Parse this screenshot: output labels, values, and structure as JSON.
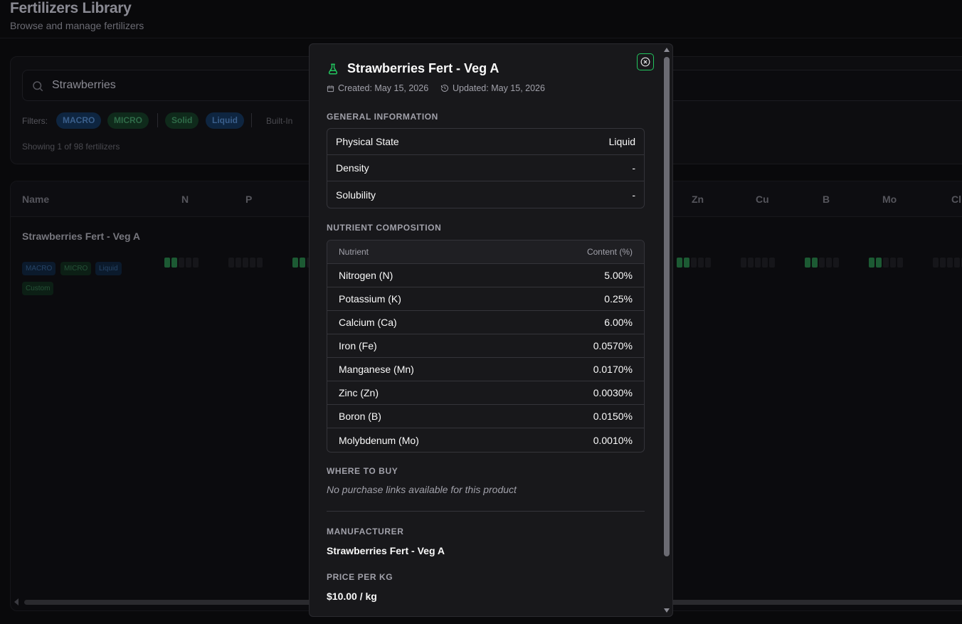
{
  "page": {
    "title": "Fertilizers Library",
    "subtitle": "Browse and manage fertilizers"
  },
  "search": {
    "value": "Strawberries",
    "filters_label": "Filters:",
    "chips": [
      "MACRO",
      "MICRO",
      "Solid",
      "Liquid"
    ],
    "more_chip": "Built-In",
    "showing": "Showing 1 of 98 fertilizers"
  },
  "table": {
    "headers": [
      "Name",
      "N",
      "P",
      "Zn",
      "Cu",
      "B",
      "Mo",
      "Cl"
    ],
    "row": {
      "name": "Strawberries Fert - Veg A",
      "tags": [
        "MACRO",
        "MICRO",
        "Liquid",
        "Custom"
      ]
    }
  },
  "modal": {
    "title": "Strawberries Fert - Veg A",
    "created": "Created: May 15, 2026",
    "updated": "Updated: May 15, 2026",
    "general_label": "GENERAL INFORMATION",
    "general": [
      {
        "label": "Physical State",
        "value": "Liquid"
      },
      {
        "label": "Density",
        "value": "-"
      },
      {
        "label": "Solubility",
        "value": "-"
      }
    ],
    "nutrient_label": "NUTRIENT COMPOSITION",
    "nutrient_headers": {
      "nutrient": "Nutrient",
      "content": "Content (%)"
    },
    "nutrients": [
      {
        "name": "Nitrogen (N)",
        "value": "5.00%"
      },
      {
        "name": "Potassium (K)",
        "value": "0.25%"
      },
      {
        "name": "Calcium (Ca)",
        "value": "6.00%"
      },
      {
        "name": "Iron (Fe)",
        "value": "0.0570%"
      },
      {
        "name": "Manganese (Mn)",
        "value": "0.0170%"
      },
      {
        "name": "Zinc (Zn)",
        "value": "0.0030%"
      },
      {
        "name": "Boron (B)",
        "value": "0.0150%"
      },
      {
        "name": "Molybdenum (Mo)",
        "value": "0.0010%"
      }
    ],
    "where_label": "WHERE TO BUY",
    "no_links": "No purchase links available for this product",
    "manufacturer_label": "MANUFACTURER",
    "manufacturer": "Strawberries Fert - Veg A",
    "price_label": "PRICE PER KG",
    "price": "$10.00 / kg"
  },
  "colors": {
    "accent": "#22c55e",
    "background": "#09090b",
    "modal_bg": "#18181b"
  }
}
